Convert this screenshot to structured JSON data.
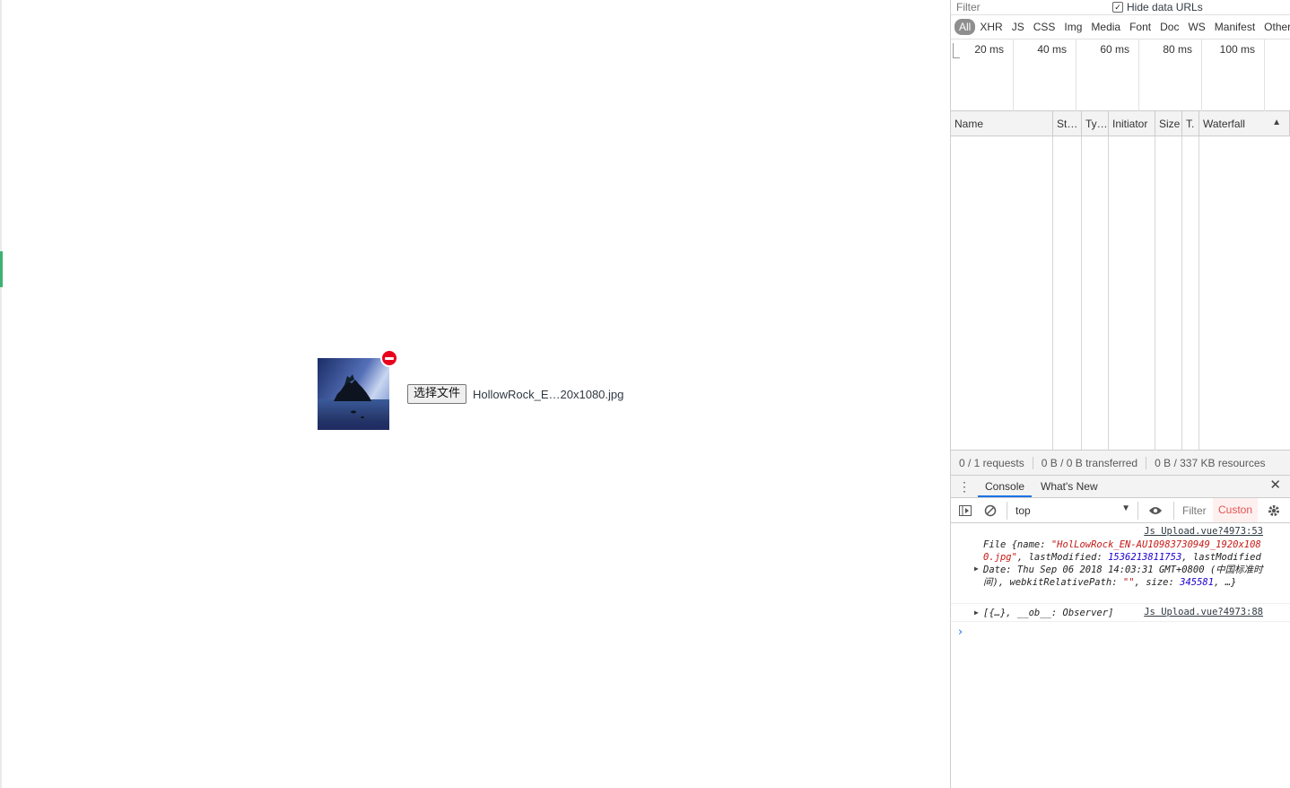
{
  "page": {
    "file_button_label": "选择文件",
    "file_name": "HollowRock_E…20x1080.jpg"
  },
  "network": {
    "filter_placeholder": "Filter",
    "hide_data_urls_label": "Hide data URLs",
    "hide_data_urls_checked": true,
    "type_filters": [
      "All",
      "XHR",
      "JS",
      "CSS",
      "Img",
      "Media",
      "Font",
      "Doc",
      "WS",
      "Manifest",
      "Other"
    ],
    "active_type": "All",
    "timeline_ticks": [
      "20 ms",
      "40 ms",
      "60 ms",
      "80 ms",
      "100 ms"
    ],
    "columns": [
      "Name",
      "St…",
      "Ty…",
      "Initiator",
      "Size",
      "T.",
      "Waterfall"
    ],
    "summary": {
      "requests": "0 / 1 requests",
      "transferred": "0 B / 0 B transferred",
      "resources": "0 B / 337 KB resources"
    }
  },
  "drawer": {
    "tabs": [
      "Console",
      "What's New"
    ],
    "active_tab": "Console"
  },
  "console": {
    "context": "top",
    "filter_placeholder": "Filter",
    "levels_label": "Custon",
    "messages": [
      {
        "source": "Js Upload.vue?4973:53",
        "prefix": "File {name: ",
        "name": "\"HolLowRock_EN-AU10983730949_1920x1080.jpg\"",
        "mid1": ", lastModified: ",
        "last_modified": "1536213811753",
        "mid2": ", lastModifiedDate: Thu Sep 06 2018 14:03:31 GMT+0800 (中国标准时间), webkitRelativePath: ",
        "relative_path": "\"\"",
        "mid3": ", size: ",
        "size": "345581",
        "suffix": ", …}"
      },
      {
        "source": "Js Upload.vue?4973:88",
        "text": "[{…}, __ob__: Observer]"
      }
    ],
    "prompt": "›"
  },
  "colors": {
    "remove_badge": "#e8001c",
    "active_tab_underline": "#1a73e8",
    "string_value": "#c41a16",
    "number_value": "#1c00cf"
  }
}
